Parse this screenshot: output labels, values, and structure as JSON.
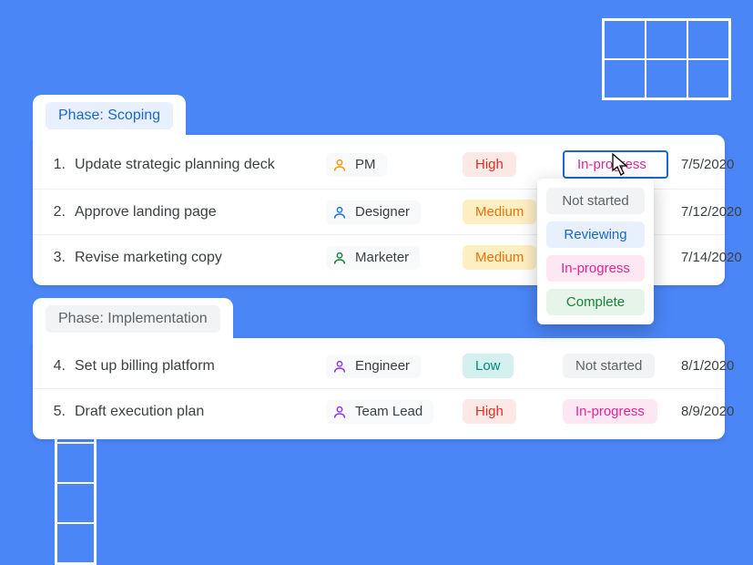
{
  "phases": [
    {
      "label": "Phase: Scoping",
      "active": true,
      "rows": [
        {
          "n": "1.",
          "task": "Update strategic planning deck",
          "role": "PM",
          "roleColor": "#f29900",
          "priority": "High",
          "priClass": "pri-high",
          "status": "In-progress",
          "statClass": "status-selected",
          "date": "7/5/2020",
          "selected": true
        },
        {
          "n": "2.",
          "task": "Approve landing page",
          "role": "Designer",
          "roleColor": "#1a73e8",
          "priority": "Medium",
          "priClass": "pri-medium",
          "status": "",
          "statClass": "",
          "date": "7/12/2020"
        },
        {
          "n": "3.",
          "task": "Revise marketing copy",
          "role": "Marketer",
          "roleColor": "#188038",
          "priority": "Medium",
          "priClass": "pri-medium",
          "status": "",
          "statClass": "",
          "date": "7/14/2020"
        }
      ]
    },
    {
      "label": "Phase: Implementation",
      "active": false,
      "rows": [
        {
          "n": "4.",
          "task": "Set up billing platform",
          "role": "Engineer",
          "roleColor": "#9334e6",
          "priority": "Low",
          "priClass": "pri-low",
          "status": "Not started",
          "statClass": "stat-notstarted",
          "date": "8/1/2020"
        },
        {
          "n": "5.",
          "task": "Draft execution plan",
          "role": "Team Lead",
          "roleColor": "#9334e6",
          "priority": "High",
          "priClass": "pri-high",
          "status": "In-progress",
          "statClass": "stat-inprogress",
          "date": "8/9/2020"
        }
      ]
    }
  ],
  "dropdown": [
    {
      "label": "Not started",
      "cls": "stat-notstarted"
    },
    {
      "label": "Reviewing",
      "cls": "stat-reviewing"
    },
    {
      "label": "In-progress",
      "cls": "stat-inprogress"
    },
    {
      "label": "Complete",
      "cls": "stat-complete"
    }
  ]
}
